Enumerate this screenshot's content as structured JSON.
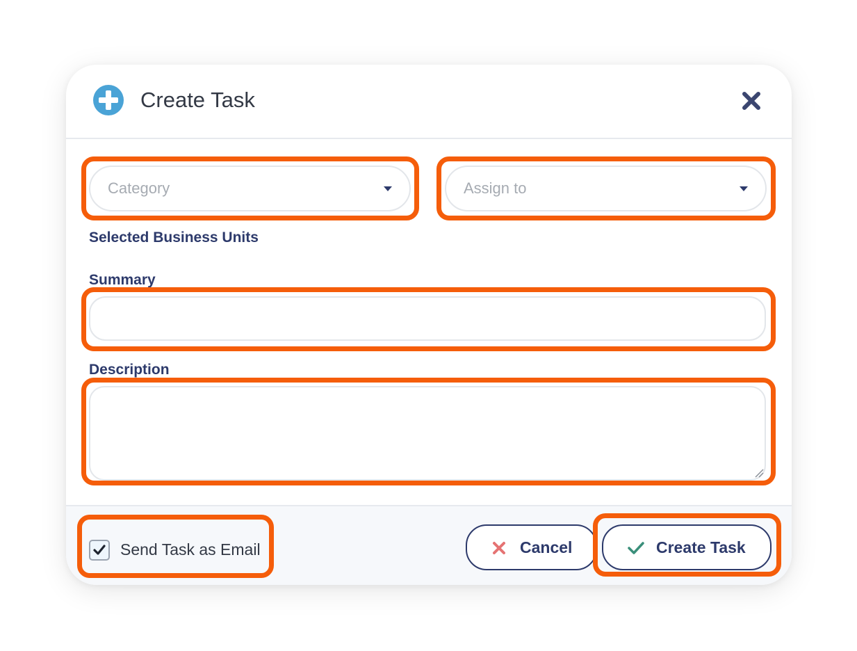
{
  "dialog": {
    "title": "Create Task",
    "header_icon": "plus-circle-icon",
    "close_icon": "close-icon"
  },
  "form": {
    "category": {
      "placeholder": "Category"
    },
    "assign_to": {
      "placeholder": "Assign to"
    },
    "selected_units_label": "Selected Business Units",
    "summary": {
      "label": "Summary",
      "value": ""
    },
    "description": {
      "label": "Description",
      "value": ""
    }
  },
  "footer": {
    "send_email": {
      "label": "Send Task as Email",
      "checked": true
    },
    "cancel_label": "Cancel",
    "create_label": "Create Task"
  },
  "colors": {
    "accent_blue": "#4aa3d6",
    "navy": "#2d3a6b",
    "highlight": "#f55d0a",
    "cancel_icon": "#e57373",
    "check_icon": "#3a8f7a"
  }
}
